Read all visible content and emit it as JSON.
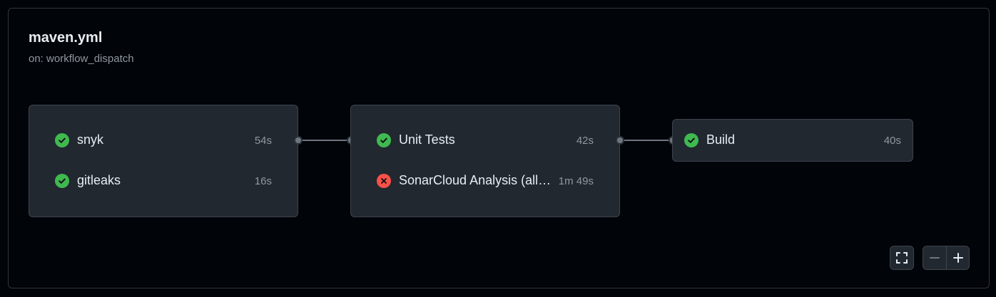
{
  "workflow": {
    "title": "maven.yml",
    "trigger": "on: workflow_dispatch"
  },
  "stages": [
    {
      "jobs": [
        {
          "name": "snyk",
          "duration": "54s",
          "status": "success"
        },
        {
          "name": "gitleaks",
          "duration": "16s",
          "status": "success"
        }
      ]
    },
    {
      "jobs": [
        {
          "name": "Unit Tests",
          "duration": "42s",
          "status": "success"
        },
        {
          "name": "SonarCloud Analysis (all…",
          "duration": "1m 49s",
          "status": "failure"
        }
      ]
    },
    {
      "jobs": [
        {
          "name": "Build",
          "duration": "40s",
          "status": "success"
        }
      ]
    }
  ],
  "controls": {
    "fullscreen_icon": "fullscreen-icon",
    "zoom_out_icon": "minus-icon",
    "zoom_in_icon": "plus-icon"
  },
  "colors": {
    "success": "#3fb950",
    "failure": "#f85149",
    "background": "#010409",
    "card": "#212830"
  }
}
